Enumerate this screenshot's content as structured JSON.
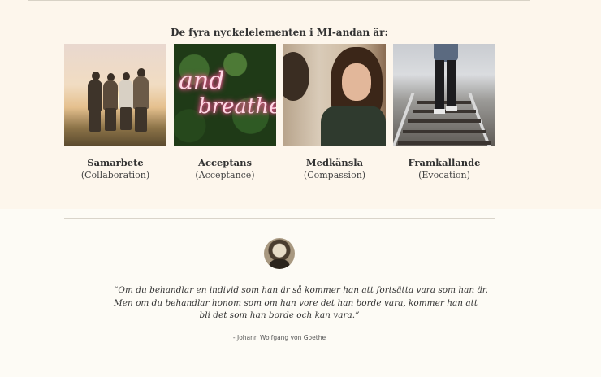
{
  "section": {
    "heading": "De fyra nyckelelementen i MI-andan är:"
  },
  "elements": [
    {
      "title": "Samarbete",
      "subtitle": "(Collaboration)",
      "image": "group-sunset-photo"
    },
    {
      "title": "Acceptans",
      "subtitle": "(Acceptance)",
      "image": "neon-and-breathe-photo"
    },
    {
      "title": "Medkänsla",
      "subtitle": "(Compassion)",
      "image": "thoughtful-woman-photo"
    },
    {
      "title": "Framkallande",
      "subtitle": "(Evocation)",
      "image": "railway-walker-photo"
    }
  ],
  "neon_text": {
    "line1": "and",
    "line2": "breathe"
  },
  "quote": {
    "line1": "“Om du behandlar en individ som han är så kommer han att fortsätta vara som han är.",
    "line2": "Men om du behandlar honom som om han vore det han borde vara, kommer han att",
    "line3": "bli det som han borde och kan vara.”",
    "author": "- Johann Wolfgang von Goethe"
  },
  "colors": {
    "top_band": "#fdf6ec",
    "page": "#fdfbf5",
    "text": "#333333"
  }
}
